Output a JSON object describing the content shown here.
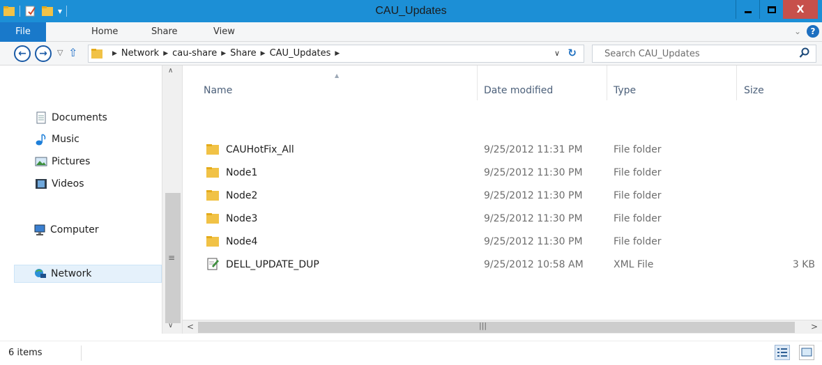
{
  "window": {
    "title": "CAU_Updates",
    "controls": {
      "minimize": "_",
      "maximize": "□",
      "close": "X"
    }
  },
  "ribbon": {
    "tabs": [
      {
        "label": "File"
      },
      {
        "label": "Home"
      },
      {
        "label": "Share"
      },
      {
        "label": "View"
      }
    ],
    "help": "?"
  },
  "address": {
    "crumbs": [
      "Network",
      "cau-share",
      "Share",
      "CAU_Updates"
    ]
  },
  "search": {
    "placeholder": "Search CAU_Updates"
  },
  "nav_pane": {
    "items": [
      {
        "label": "Documents",
        "icon": "documents-icon"
      },
      {
        "label": "Music",
        "icon": "music-icon"
      },
      {
        "label": "Pictures",
        "icon": "pictures-icon"
      },
      {
        "label": "Videos",
        "icon": "videos-icon"
      },
      {
        "label": "Computer",
        "icon": "computer-icon"
      },
      {
        "label": "Network",
        "icon": "network-icon",
        "selected": true
      }
    ]
  },
  "columns": [
    {
      "label": "Name"
    },
    {
      "label": "Date modified"
    },
    {
      "label": "Type"
    },
    {
      "label": "Size"
    }
  ],
  "files": [
    {
      "name": "CAUHotFix_All",
      "date": "9/25/2012 11:31 PM",
      "type": "File folder",
      "size": "",
      "icon": "folder-icon"
    },
    {
      "name": "Node1",
      "date": "9/25/2012 11:30 PM",
      "type": "File folder",
      "size": "",
      "icon": "folder-icon"
    },
    {
      "name": "Node2",
      "date": "9/25/2012 11:30 PM",
      "type": "File folder",
      "size": "",
      "icon": "folder-icon"
    },
    {
      "name": "Node3",
      "date": "9/25/2012 11:30 PM",
      "type": "File folder",
      "size": "",
      "icon": "folder-icon"
    },
    {
      "name": "Node4",
      "date": "9/25/2012 11:30 PM",
      "type": "File folder",
      "size": "",
      "icon": "folder-icon"
    },
    {
      "name": "DELL_UPDATE_DUP",
      "date": "9/25/2012 10:58 AM",
      "type": "XML File",
      "size": "3 KB",
      "icon": "xml-file-icon"
    }
  ],
  "status": {
    "item_count": "6 items"
  },
  "colors": {
    "titlebar": "#1c8fd6",
    "file_tab": "#1979ca",
    "close_button": "#c7504b",
    "selection": "#e5f1fb"
  }
}
